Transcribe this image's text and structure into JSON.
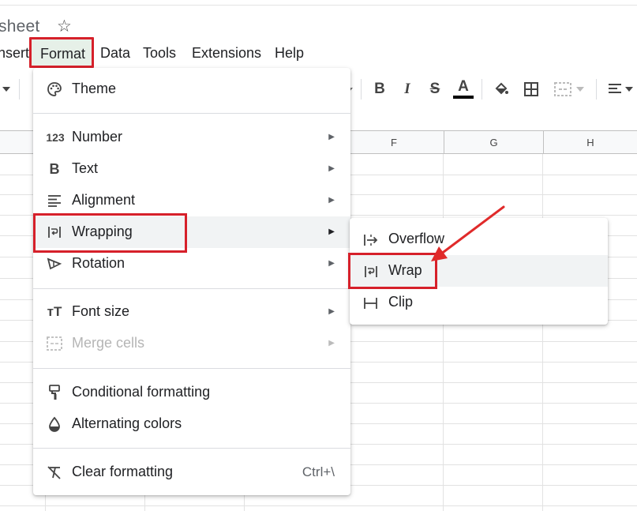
{
  "doc": {
    "title_partial": "sheet"
  },
  "menubar": {
    "items": [
      "nsert",
      "Format",
      "Data",
      "Tools",
      "Extensions",
      "Help"
    ],
    "active": "Format"
  },
  "toolbar": {
    "icons": [
      "dropdown-caret-icon",
      "bold-icon",
      "italic-icon",
      "strikethrough-icon",
      "text-color-icon",
      "fill-color-icon",
      "borders-icon",
      "merge-cells-icon",
      "align-icon"
    ],
    "bold_glyph": "B",
    "italic_glyph": "I",
    "strike_glyph": "S",
    "text_color_glyph": "A",
    "text_color_bar": "#000000"
  },
  "columns": [
    "F",
    "G",
    "H"
  ],
  "format_menu": {
    "items": [
      {
        "label": "Theme",
        "icon": "palette-icon"
      },
      {
        "label": "Number",
        "icon": "number-format-icon",
        "icon_text": "123",
        "submenu": true
      },
      {
        "label": "Text",
        "icon": "bold-text-icon",
        "icon_text": "B",
        "submenu": true
      },
      {
        "label": "Alignment",
        "icon": "alignment-icon",
        "submenu": true
      },
      {
        "label": "Wrapping",
        "icon": "wrap-icon",
        "submenu": true,
        "highlighted": true
      },
      {
        "label": "Rotation",
        "icon": "rotation-icon",
        "submenu": true
      },
      {
        "label": "Font size",
        "icon": "font-size-icon",
        "icon_text": "ᴛT",
        "submenu": true
      },
      {
        "label": "Merge cells",
        "icon": "merge-cells-icon",
        "submenu": true,
        "disabled": true
      },
      {
        "label": "Conditional formatting",
        "icon": "paint-roller-icon"
      },
      {
        "label": "Alternating colors",
        "icon": "alternating-colors-icon"
      },
      {
        "label": "Clear formatting",
        "icon": "clear-formatting-icon",
        "shortcut": "Ctrl+\\"
      }
    ]
  },
  "wrapping_submenu": {
    "items": [
      {
        "label": "Overflow",
        "icon": "overflow-icon"
      },
      {
        "label": "Wrap",
        "icon": "wrap-icon",
        "highlighted": true
      },
      {
        "label": "Clip",
        "icon": "clip-icon"
      }
    ]
  },
  "colors": {
    "highlight_border": "#d6202a",
    "menu_active_bg": "#e6f0e8",
    "hover_bg": "#f1f3f4",
    "annotation_arrow": "#e02a2a"
  }
}
